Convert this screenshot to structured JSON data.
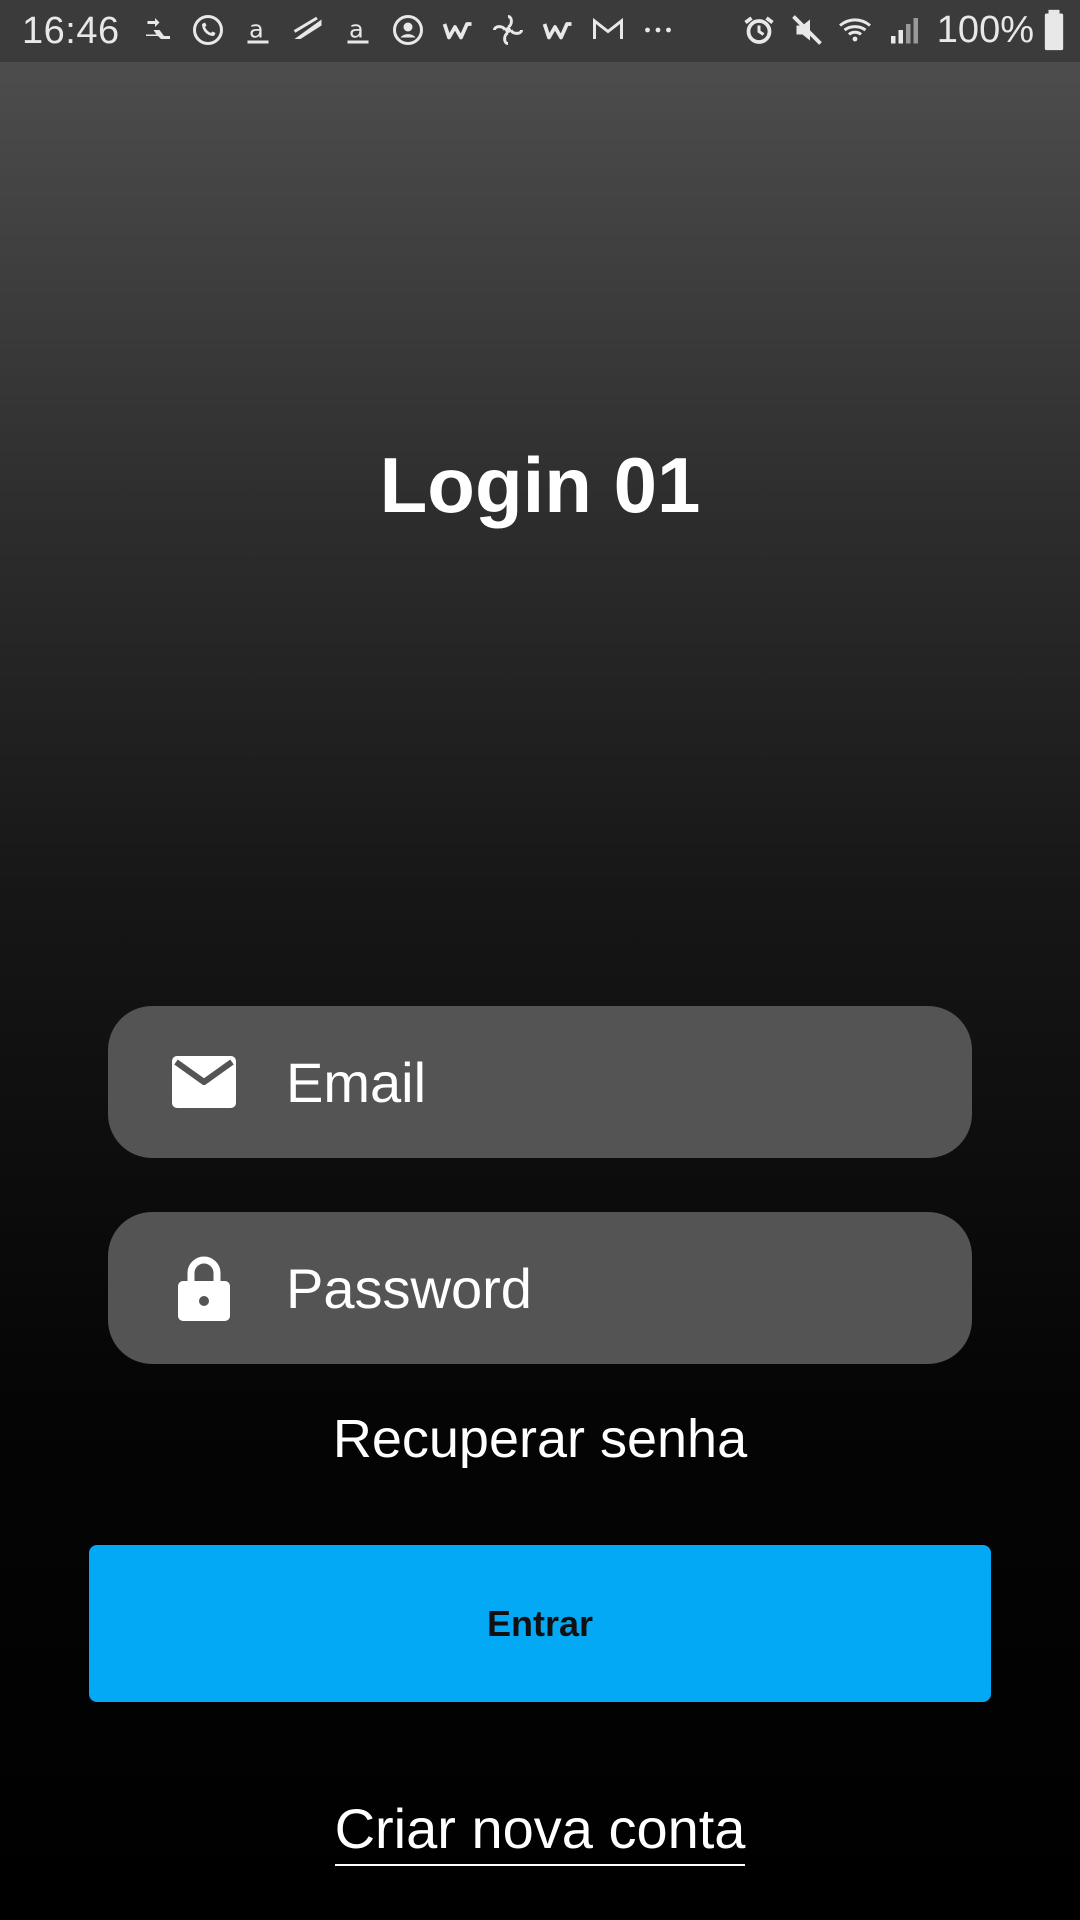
{
  "status_bar": {
    "time": "16:46",
    "battery_percent": "100%",
    "notification_icons": [
      "transfer-icon",
      "whatsapp-icon",
      "amazon-icon",
      "feather-icon",
      "amazon-icon",
      "user-circle-icon",
      "w-app-icon",
      "fan-icon",
      "w-app-icon",
      "gmail-icon",
      "more-icon"
    ],
    "system_icons": [
      "alarm-icon",
      "mute-icon",
      "wifi-icon",
      "signal-icon",
      "battery-icon"
    ]
  },
  "login": {
    "title": "Login 01",
    "email_placeholder": "Email",
    "email_value": "",
    "password_placeholder": "Password",
    "password_value": "",
    "recover_label": "Recuperar senha",
    "enter_label": "Entrar",
    "create_account_label": "Criar nova conta"
  },
  "colors": {
    "accent": "#03a9f4",
    "field_bg": "#545454",
    "text": "#ffffff"
  }
}
